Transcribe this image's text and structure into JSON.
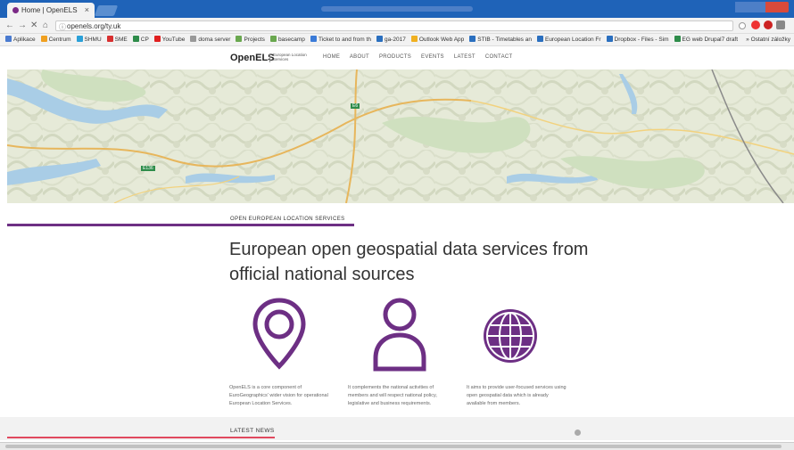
{
  "browser": {
    "tab_title": "Home | OpenELS",
    "tab_close": "×",
    "url": "openels.org/ty.uk",
    "back": "←",
    "forward": "→",
    "stop": "✕",
    "home": "⌂",
    "bookmarks": [
      {
        "label": "Aplikace",
        "color": "#4a7bd0"
      },
      {
        "label": "Centrum",
        "color": "#f0a020"
      },
      {
        "label": "SHMU",
        "color": "#2aa0d8"
      },
      {
        "label": "SME",
        "color": "#d83030"
      },
      {
        "label": "CP",
        "color": "#2e8c4a"
      },
      {
        "label": "YouTube",
        "color": "#e02020"
      },
      {
        "label": "doma server",
        "color": "#999999"
      },
      {
        "label": "Projects",
        "color": "#6aa84f"
      },
      {
        "label": "basecamp",
        "color": "#6aa84f"
      },
      {
        "label": "Ticket to and from th",
        "color": "#3b7bd8"
      },
      {
        "label": "ga-2017",
        "color": "#2a6fbf"
      },
      {
        "label": "Outlook Web App",
        "color": "#f0b020"
      },
      {
        "label": "STIB - Timetables an",
        "color": "#2a6fbf"
      },
      {
        "label": "European Location Fr",
        "color": "#2a6fbf"
      },
      {
        "label": "Dropbox - Files - Sim",
        "color": "#2a6fbf"
      },
      {
        "label": "EG web Drupal7 draft",
        "color": "#2e8c4a"
      }
    ],
    "bookmarks_more": "»",
    "bookmarks_other": "Ostatní záložky"
  },
  "site": {
    "logo": "OpenELS",
    "logo_sub": "European Location Services",
    "menu": [
      "HOME",
      "ABOUT",
      "PRODUCTS",
      "EVENTS",
      "LATEST",
      "CONTACT"
    ]
  },
  "map": {
    "road_labels": [
      "E6",
      "E136"
    ]
  },
  "content": {
    "kicker": "OPEN EUROPEAN LOCATION SERVICES",
    "headline": "European open geospatial data services from official national sources",
    "features": [
      {
        "icon": "location-pin-icon",
        "text": "OpenELS is a core component of EuroGeographics' wider vision for operational European Location Services."
      },
      {
        "icon": "person-icon",
        "text": "It complements the national activities of members and will respect national policy, legislative and business requirements."
      },
      {
        "icon": "globe-icon",
        "text": "It aims to provide user-focused services using open geospatial data which is already available from members."
      }
    ],
    "latest_news": "LATEST NEWS"
  },
  "colors": {
    "brand_purple": "#6d2f84",
    "news_accent": "#e0485e",
    "tabbar": "#1f63b8"
  }
}
